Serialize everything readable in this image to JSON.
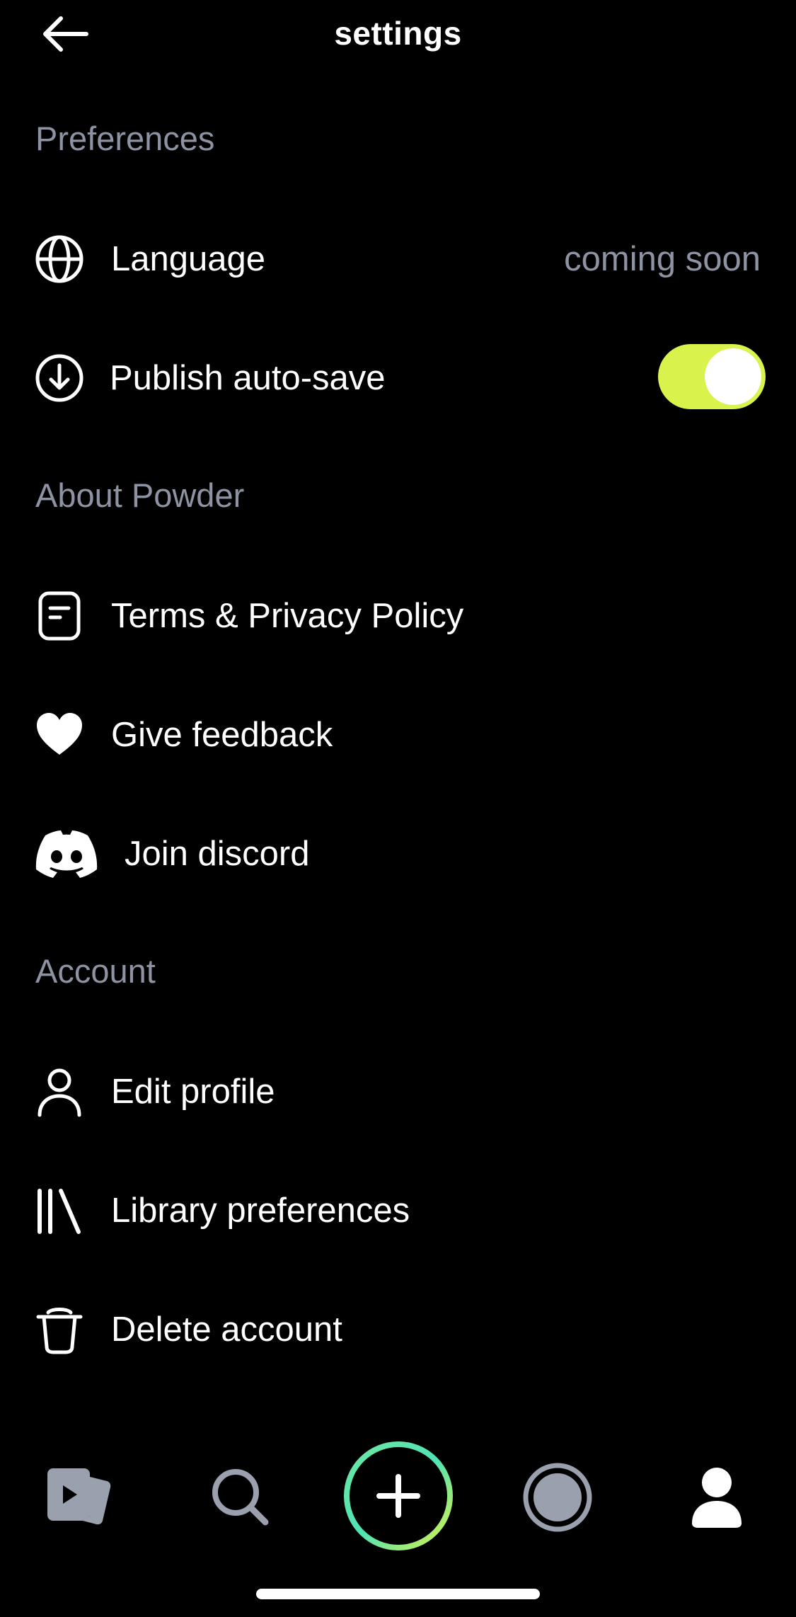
{
  "header": {
    "title": "settings",
    "back_icon": "arrow-left-icon"
  },
  "sections": {
    "preferences": "Preferences",
    "about": "About Powder",
    "account": "Account"
  },
  "preferences": {
    "language": {
      "label": "Language",
      "value": "coming soon",
      "icon": "globe-icon"
    },
    "autosave": {
      "label": "Publish auto-save",
      "icon": "download-circle-icon",
      "enabled": true
    }
  },
  "about": {
    "terms": {
      "label": "Terms & Privacy Policy",
      "icon": "document-icon"
    },
    "feedback": {
      "label": "Give feedback",
      "icon": "heart-icon"
    },
    "discord": {
      "label": "Join discord",
      "icon": "discord-icon"
    }
  },
  "account": {
    "edit_profile": {
      "label": "Edit profile",
      "icon": "person-icon"
    },
    "library": {
      "label": "Library preferences",
      "icon": "library-icon"
    },
    "delete": {
      "label": "Delete account",
      "icon": "trash-icon"
    }
  },
  "tabbar": {
    "items": [
      "video-clips-icon",
      "search-icon",
      "create-plus-icon",
      "record-icon",
      "profile-icon"
    ]
  },
  "colors": {
    "background": "#000000",
    "text": "#ffffff",
    "muted": "#8e93a3",
    "toggle_on": "#d9f24c",
    "tab_inactive": "#9aa0ad",
    "ring_start": "#6ee7a0",
    "ring_end": "#d9f24c"
  }
}
